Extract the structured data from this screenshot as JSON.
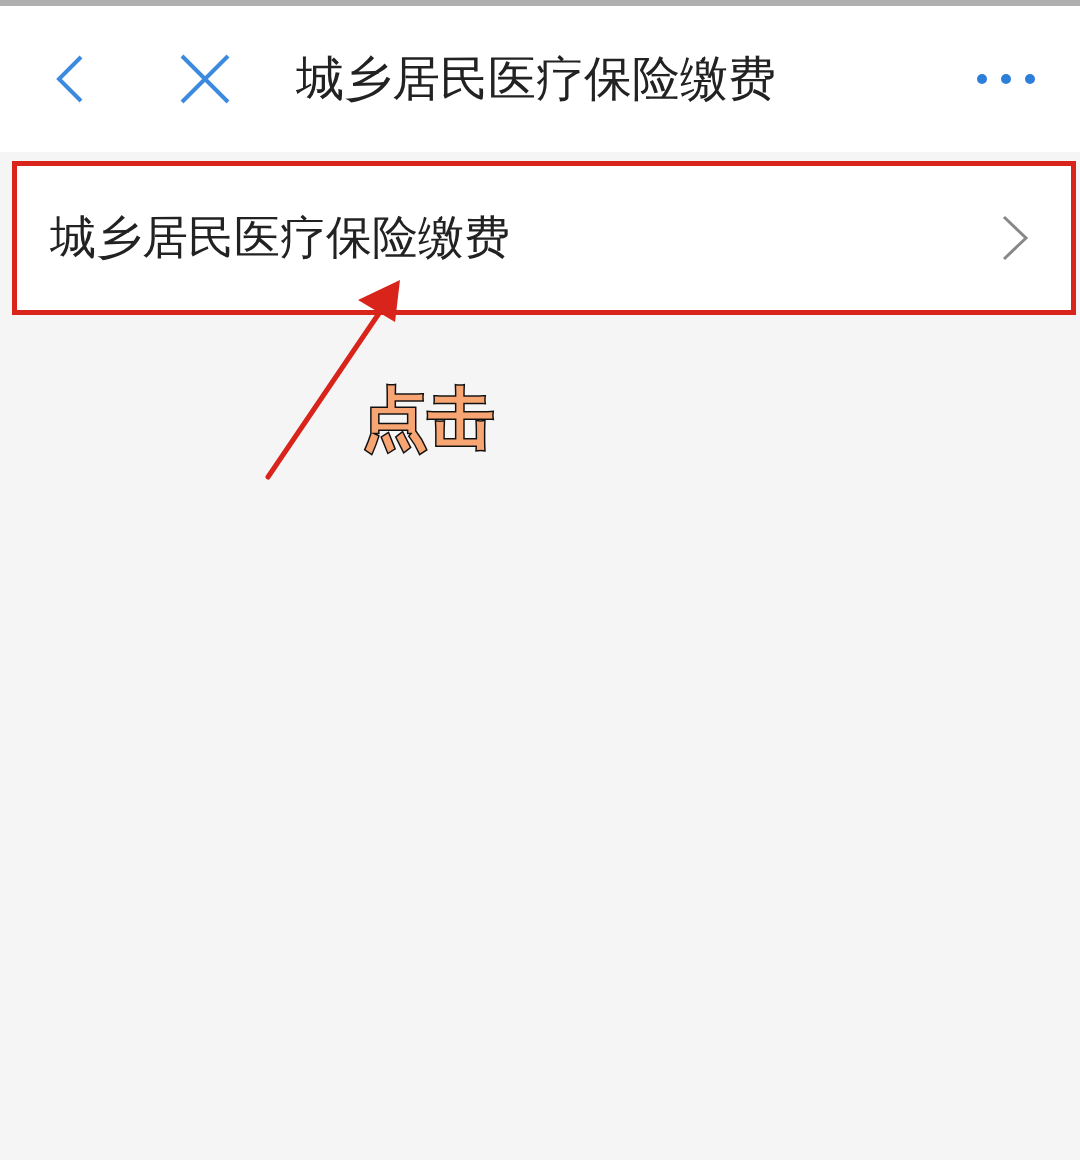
{
  "header": {
    "title": "城乡居民医疗保险缴费"
  },
  "list": {
    "items": [
      {
        "label": "城乡居民医疗保险缴费",
        "highlighted": true
      }
    ]
  },
  "annotation": {
    "callout": "点击"
  }
}
